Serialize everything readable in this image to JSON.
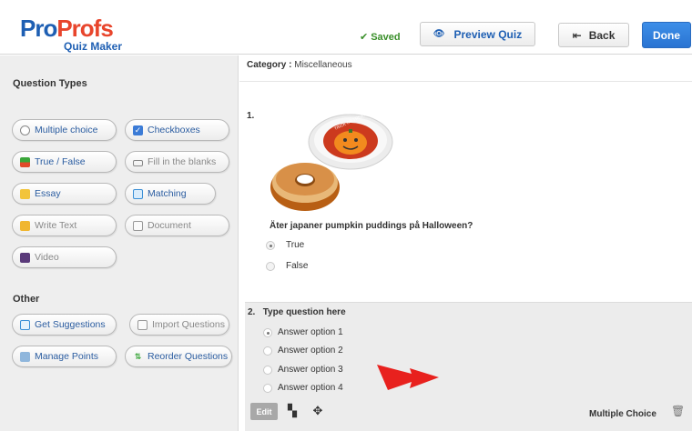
{
  "header": {
    "logo_part1": "Pro",
    "logo_part2": "Profs",
    "logo_sub": "Quiz Maker",
    "saved_label": "Saved",
    "preview_label": "Preview Quiz",
    "back_label": "Back",
    "done_label": "Done"
  },
  "sidebar": {
    "question_types_title": "Question Types",
    "question_types": [
      {
        "label": "Multiple choice",
        "icon": "radio-icon"
      },
      {
        "label": "Checkboxes",
        "icon": "checkbox-icon"
      },
      {
        "label": "True / False",
        "icon": "true-false-icon"
      },
      {
        "label": "Fill in the blanks",
        "icon": "fill-blank-icon"
      },
      {
        "label": "Essay",
        "icon": "essay-icon"
      },
      {
        "label": "Matching",
        "icon": "matching-icon"
      },
      {
        "label": "Write Text",
        "icon": "write-text-icon"
      },
      {
        "label": "Document",
        "icon": "document-icon"
      },
      {
        "label": "Video",
        "icon": "video-icon"
      }
    ],
    "other_title": "Other",
    "other": [
      {
        "label": "Get Suggestions",
        "icon": "suggestions-icon"
      },
      {
        "label": "Import Questions",
        "icon": "import-icon"
      },
      {
        "label": "Manage Points",
        "icon": "points-icon"
      },
      {
        "label": "Reorder Questions",
        "icon": "reorder-icon"
      }
    ]
  },
  "main": {
    "category_label": "Category :",
    "category_value": "Miscellaneous",
    "q1": {
      "number": "1.",
      "text": "Äter japaner pumpkin puddings på Halloween?",
      "image_label": "TRICK OR TREAT",
      "options": [
        {
          "label": "True",
          "selected": true
        },
        {
          "label": "False",
          "selected": false
        }
      ]
    },
    "q2": {
      "number": "2.",
      "title": "Type question here",
      "options": [
        {
          "label": "Answer option 1",
          "selected": true
        },
        {
          "label": "Answer option 2",
          "selected": false
        },
        {
          "label": "Answer option 3",
          "selected": false
        },
        {
          "label": "Answer option 4",
          "selected": false
        }
      ],
      "edit_label": "Edit",
      "type_label": "Multiple Choice"
    }
  },
  "colors": {
    "brand_blue": "#1e5fb3",
    "brand_red": "#e8452c",
    "saved_green": "#3a8f2a",
    "done_blue": "#2a74d2",
    "arrow_red": "#e8211e"
  }
}
